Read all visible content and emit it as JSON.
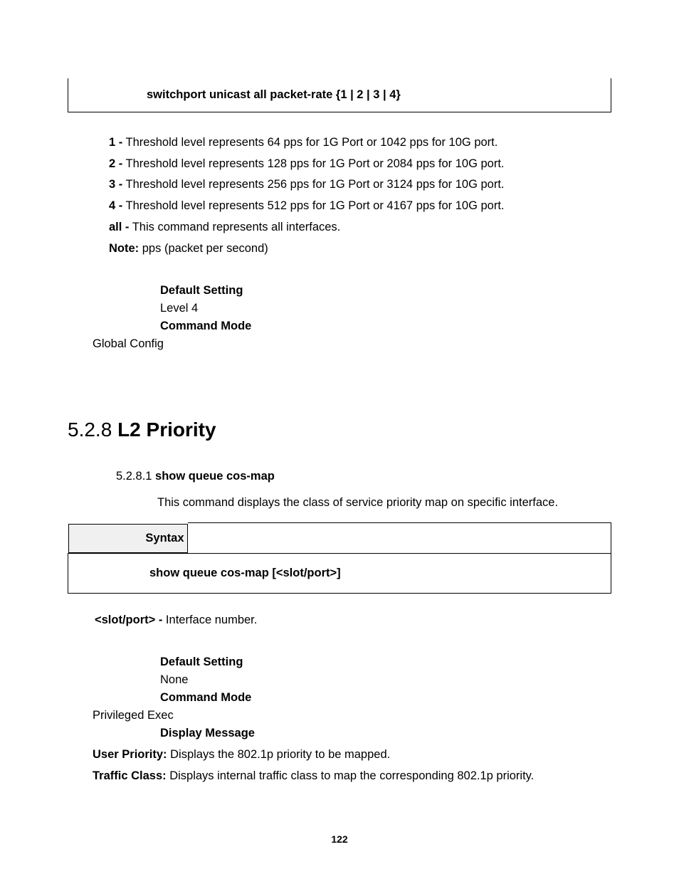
{
  "cmdbox1": "switchport unicast all packet-rate {1 | 2 | 3 | 4}",
  "levels": {
    "l1": {
      "b": "1 -",
      "t": " Threshold level represents 64 pps for 1G Port or 1042 pps for 10G port."
    },
    "l2": {
      "b": "2 -",
      "t": " Threshold level represents 128 pps for 1G Port or 2084 pps for 10G port."
    },
    "l3": {
      "b": "3 -",
      "t": " Threshold level represents 256 pps for 1G Port or 3124 pps for 10G port."
    },
    "l4": {
      "b": "4 -",
      "t": " Threshold level represents 512 pps for 1G Port or 4167 pps for 10G port."
    },
    "all": {
      "b": "all -",
      "t": " This command represents all interfaces."
    }
  },
  "note": {
    "b": "Note:",
    "t": " pps (packet per second)"
  },
  "block1": {
    "defset_label": "Default Setting",
    "defset_val": "Level 4",
    "cmdmode_label": "Command Mode",
    "cmdmode_val": "Global Config"
  },
  "section": {
    "num": "5.2.8 ",
    "title": "L2 Priority"
  },
  "sub": {
    "num": "5.2.8.1 ",
    "title": "show queue cos-map",
    "desc": "This command displays the class of service priority map on specific interface."
  },
  "syntax_label": "Syntax",
  "cmdbox2": "show queue cos-map [<slot/port>]",
  "slot": {
    "b": "<slot/port> -",
    "t": " Interface number."
  },
  "block2": {
    "defset_label": "Default Setting",
    "defset_val": "None",
    "cmdmode_label": "Command Mode",
    "cmdmode_val": "Privileged Exec",
    "disp_label": "Display Message"
  },
  "userprio": {
    "b": "User Priority:",
    "t": " Displays the 802.1p priority to be mapped."
  },
  "traffic": {
    "b": "Traffic Class:",
    "t": " Displays internal traffic class to map the corresponding 802.1p priority."
  },
  "pagenum": "122"
}
